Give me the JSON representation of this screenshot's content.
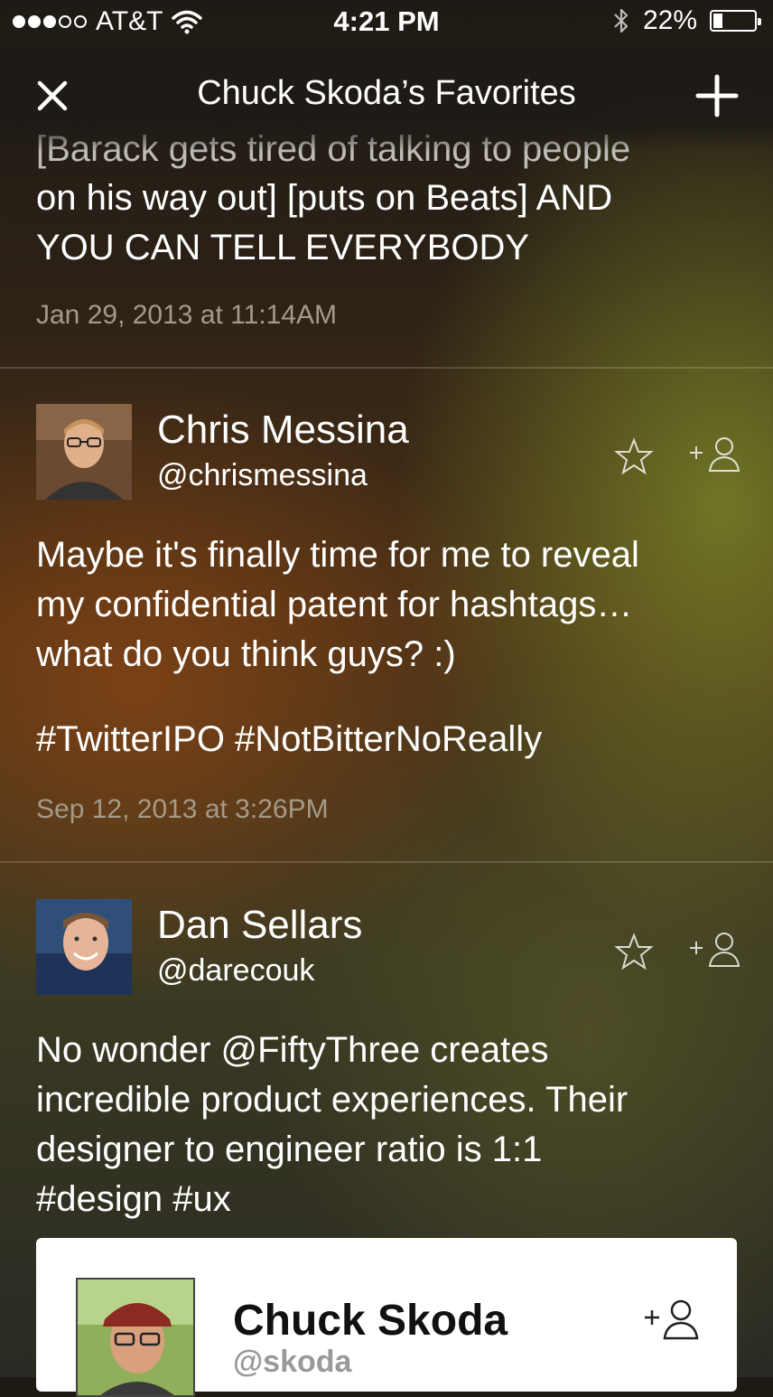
{
  "status_bar": {
    "carrier": "AT&T",
    "time": "4:21 PM",
    "battery": "22%",
    "battery_level": 0.22,
    "signal_bars": 3,
    "signal_total": 5
  },
  "nav": {
    "title": "Chuck Skoda’s Favorites"
  },
  "tweets": [
    {
      "text_partial_top": "[Barack gets tired of talking to people",
      "text": "on his way out] [puts on Beats] AND\nYOU CAN TELL EVERYBODY",
      "timestamp": "Jan 29, 2013 at 11:14AM"
    },
    {
      "author_name": "Chris Messina",
      "author_handle": "@chrismessina",
      "text": "Maybe it's finally time for me to reveal\nmy confidential patent for hashtags…\nwhat do you think guys? :)",
      "hashtags": "#TwitterIPO #NotBitterNoReally",
      "timestamp": "Sep 12, 2013 at 3:26PM"
    },
    {
      "author_name": "Dan Sellars",
      "author_handle": "@darecouk",
      "text": "No wonder @FiftyThree creates\nincredible product experiences. Their\ndesigner to engineer ratio is 1:1\n#design #ux"
    }
  ],
  "profile_card": {
    "name": "Chuck Skoda",
    "handle": "@skoda"
  },
  "colors": {
    "card_background": "#ffffff",
    "timestamp": "#a59a88"
  },
  "icons": {
    "close": "close-icon",
    "add": "plus-icon",
    "favorite": "star-icon",
    "follow": "add-user-icon"
  }
}
